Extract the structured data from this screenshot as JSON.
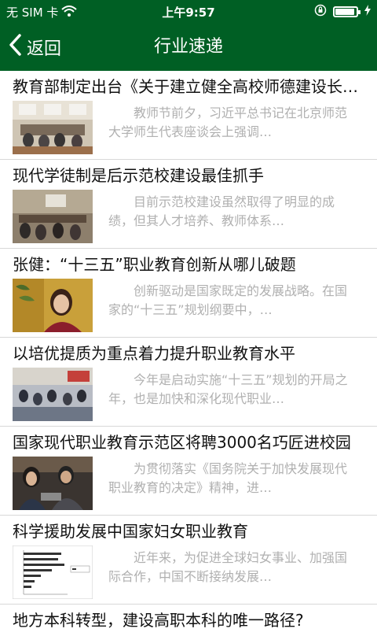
{
  "status_bar": {
    "carrier": "无 SIM 卡",
    "time": "上午9:57",
    "icons": [
      "wifi-icon",
      "rotation-lock-icon",
      "battery-icon",
      "charging-icon"
    ]
  },
  "nav": {
    "back_label": "返回",
    "title": "行业速递"
  },
  "colors": {
    "header_bg": "#005f24",
    "title_text": "#111111",
    "summary_text": "#b0b0b0"
  },
  "news": [
    {
      "title": "教育部制定出台《关于建立健全高校师德建设长效机制的意见》",
      "summary": "教师节前夕，习近平总书记在北京师范大学师生代表座谈会上强调…"
    },
    {
      "title": "现代学徒制是后示范校建设最佳抓手",
      "summary": "目前示范校建设虽然取得了明显的成绩，但其人才培养、教师体系…"
    },
    {
      "title": "张健：“十三五”职业教育创新从哪儿破题",
      "summary": "创新驱动是国家既定的发展战略。在国家的“十三五”规划纲要中，…"
    },
    {
      "title": "以培优提质为重点着力提升职业教育水平",
      "summary": "今年是启动实施“十三五”规划的开局之年，也是加快和深化现代职业…"
    },
    {
      "title": "国家现代职业教育示范区将聘3000名巧匠进校园",
      "summary": "为贯彻落实《国务院关于加快发展现代职业教育的决定》精神，进…"
    },
    {
      "title": "科学援助发展中国家妇女职业教育",
      "summary": "近年来，为促进全球妇女事业、加强国际合作，中国不断接纳发展…"
    },
    {
      "title": "地方本科转型，建设高职本科的唯一路径?"
    }
  ]
}
